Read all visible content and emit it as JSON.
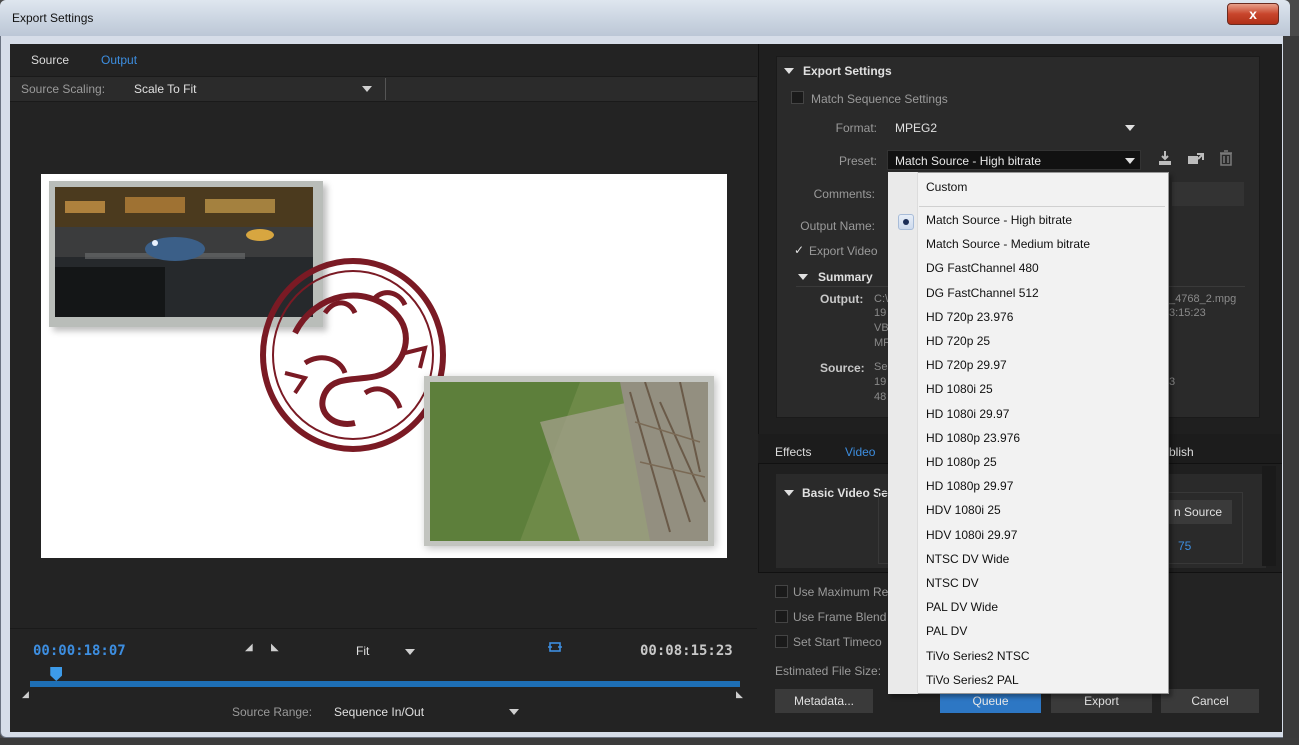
{
  "window": {
    "title": "Export Settings",
    "close_glyph": "x"
  },
  "left": {
    "tabs": [
      {
        "label": "Source"
      },
      {
        "label": "Output"
      }
    ],
    "scaling": {
      "label": "Source Scaling:",
      "value": "Scale To Fit"
    },
    "timeline": {
      "current_time": "00:00:18:07",
      "duration": "00:08:15:23",
      "zoom": "Fit",
      "source_range_label": "Source Range:",
      "source_range_value": "Sequence In/Out",
      "playhead_fraction": 0.037
    }
  },
  "right": {
    "export_settings": {
      "heading": "Export Settings",
      "match_sequence_label": "Match Sequence Settings",
      "format_label": "Format:",
      "format_value": "MPEG2",
      "preset_label": "Preset:",
      "preset_value": "Match Source - High bitrate",
      "comments_label": "Comments:",
      "output_name_label": "Output Name:",
      "export_video_label": "Export Video",
      "summary": {
        "heading": "Summary",
        "output_label": "Output:",
        "output_left": [
          "C:\\",
          "19",
          "VB",
          "MF"
        ],
        "output_right": [
          "_4768_2.mpg",
          "3:15:23"
        ],
        "source_label": "Source:",
        "source_left": [
          "Se",
          "19",
          "48"
        ],
        "source_right": [
          "3"
        ]
      }
    },
    "tabs": [
      {
        "label": "Effects"
      },
      {
        "label": "Video"
      },
      {
        "label": "blish"
      }
    ],
    "basic_video": {
      "heading": "Basic Video Se",
      "match_source_button": "n Source",
      "quality_value": "75"
    },
    "options": {
      "max_render": "Use Maximum Re",
      "frame_blend": "Use Frame Blend",
      "start_timecode": "Set Start Timeco",
      "estimated_size": "Estimated File Size:"
    },
    "buttons": {
      "metadata": "Metadata...",
      "queue": "Queue",
      "export": "Export",
      "cancel": "Cancel"
    }
  },
  "preset_dropdown": {
    "custom": "Custom",
    "selected_index": 0,
    "items": [
      "Match Source - High bitrate",
      "Match Source - Medium bitrate",
      "DG FastChannel 480",
      "DG FastChannel 512",
      "HD 720p 23.976",
      "HD 720p 25",
      "HD 720p 29.97",
      "HD 1080i 25",
      "HD 1080i 29.97",
      "HD 1080p 23.976",
      "HD 1080p 25",
      "HD 1080p 29.97",
      "HDV 1080i 25",
      "HDV 1080i 29.97",
      "NTSC DV Wide",
      "NTSC DV",
      "PAL DV Wide",
      "PAL DV",
      "TiVo Series2 NTSC",
      "TiVo Series2 PAL"
    ]
  },
  "colors": {
    "accent": "#3d8ee0",
    "seal": "#7a1a24",
    "queue_button": "#2d77c4"
  },
  "icons": {
    "save_preset": "save-preset-icon",
    "import_preset": "import-preset-icon",
    "delete_preset": "trash-icon",
    "fit_frame": "fit-frame-icon"
  }
}
